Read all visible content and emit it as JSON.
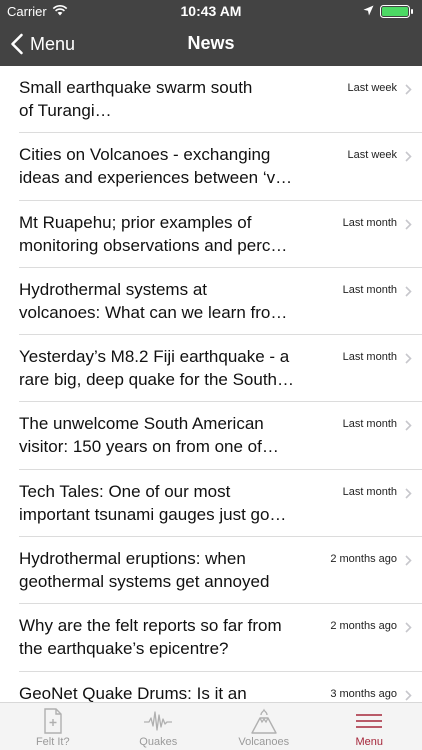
{
  "status_bar": {
    "carrier": "Carrier",
    "time": "10:43 AM"
  },
  "nav": {
    "back_label": "Menu",
    "title": "News"
  },
  "news": [
    {
      "title": "Small earthquake swarm south\nof Turangi…",
      "time": "Last week"
    },
    {
      "title": "Cities on Volcanoes - exchanging\nideas and experiences between ‘v…",
      "time": "Last week"
    },
    {
      "title": "Mt Ruapehu; prior examples of\nmonitoring observations and perc…",
      "time": "Last month"
    },
    {
      "title": "Hydrothermal systems at\nvolcanoes: What can we learn fro…",
      "time": "Last month"
    },
    {
      "title": "Yesterday’s M8.2 Fiji earthquake - a\nrare big, deep quake for the South…",
      "time": "Last month"
    },
    {
      "title": "The unwelcome South American\nvisitor: 150 years on from one of…",
      "time": "Last month"
    },
    {
      "title": "Tech Tales: One of our most\nimportant tsunami gauges just go…",
      "time": "Last month"
    },
    {
      "title": "Hydrothermal eruptions: when\ngeothermal systems get annoyed",
      "time": "2 months ago"
    },
    {
      "title": "Why are the felt reports so far from\nthe earthquake’s epicentre?",
      "time": "2 months ago"
    },
    {
      "title": "GeoNet Quake Drums: Is it an",
      "time": "3 months ago"
    }
  ],
  "tabs": [
    {
      "label": "Felt It?",
      "icon": "document-icon"
    },
    {
      "label": "Quakes",
      "icon": "seismograph-icon"
    },
    {
      "label": "Volcanoes",
      "icon": "volcano-icon"
    },
    {
      "label": "Menu",
      "icon": "menu-icon"
    }
  ],
  "colors": {
    "header_bg": "#434343",
    "accent": "#a5263a",
    "battery": "#4cd964"
  }
}
